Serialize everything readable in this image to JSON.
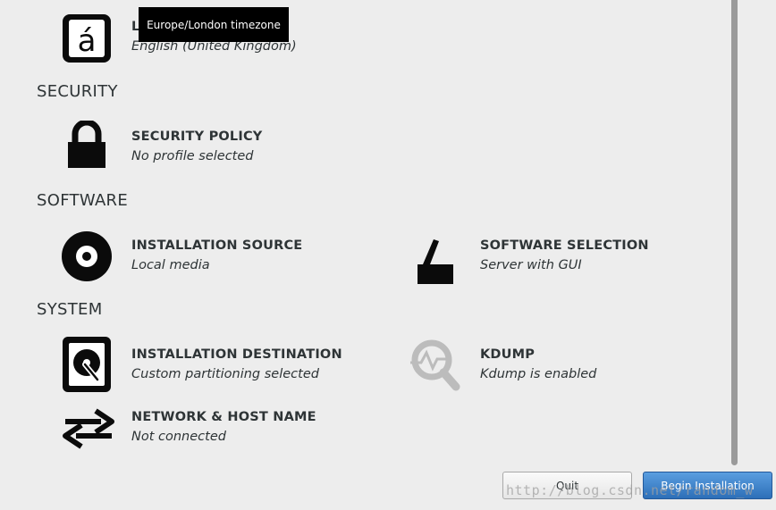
{
  "tooltip": "Europe/London timezone",
  "localization": {
    "title_partial": "L",
    "status": "English (United Kingdom)"
  },
  "sections": {
    "security": "SECURITY",
    "software": "SOFTWARE",
    "system": "SYSTEM"
  },
  "spokes": {
    "security_policy": {
      "title": "SECURITY POLICY",
      "status": "No profile selected"
    },
    "installation_source": {
      "title": "INSTALLATION SOURCE",
      "status": "Local media"
    },
    "software_selection": {
      "title": "SOFTWARE SELECTION",
      "status": "Server with GUI"
    },
    "installation_destination": {
      "title": "INSTALLATION DESTINATION",
      "status": "Custom partitioning selected"
    },
    "kdump": {
      "title": "KDUMP",
      "status": "Kdump is enabled"
    },
    "network": {
      "title": "NETWORK & HOST NAME",
      "status": "Not connected"
    }
  },
  "buttons": {
    "quit": "Quit",
    "begin": "Begin Installation"
  },
  "watermark": "http://blog.csdn.net/random_w"
}
